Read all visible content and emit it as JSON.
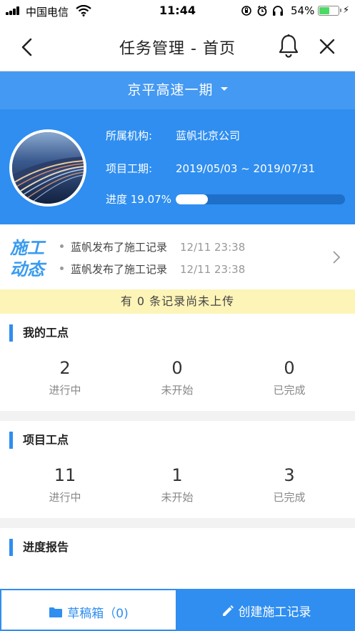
{
  "status_bar": {
    "carrier": "中国电信",
    "time": "11:44",
    "battery_percent": "54%",
    "battery_level": 0.54,
    "icons": [
      "signal-icon",
      "wifi-icon",
      "lock-rotation-icon",
      "alarm-icon",
      "headphones-icon",
      "battery-icon",
      "charging-icon"
    ]
  },
  "nav": {
    "title": "任务管理 - 首页",
    "icons": [
      "back-icon",
      "bell-icon",
      "close-icon"
    ]
  },
  "project": {
    "name": "京平高速一期",
    "org_label": "所属机构:",
    "org_value": "蓝帆北京公司",
    "period_label": "项目工期:",
    "period_value": "2019/05/03 ~ 2019/07/31",
    "progress_label": "进度 19.07%",
    "progress_value": 19.07
  },
  "activity": {
    "logo_line1": "施工",
    "logo_line2": "动态",
    "items": [
      {
        "text": "蓝帆发布了施工记录",
        "time": "12/11 23:38"
      },
      {
        "text": "蓝帆发布了施工记录",
        "time": "12/11 23:38"
      }
    ]
  },
  "upload_notice": "有 0 条记录尚未上传",
  "my_points": {
    "title": "我的工点",
    "stats": [
      {
        "value": "2",
        "label": "进行中"
      },
      {
        "value": "0",
        "label": "未开始"
      },
      {
        "value": "0",
        "label": "已完成"
      }
    ]
  },
  "project_points": {
    "title": "项目工点",
    "stats": [
      {
        "value": "11",
        "label": "进行中"
      },
      {
        "value": "1",
        "label": "未开始"
      },
      {
        "value": "3",
        "label": "已完成"
      }
    ]
  },
  "progress_report": {
    "title": "进度报告"
  },
  "bottom": {
    "draft_label": "草稿箱（0)",
    "create_label": "创建施工记录"
  },
  "colors": {
    "primary": "#2f8ef0",
    "notice_bg": "#fdf4b8",
    "battery_green": "#4cd964"
  }
}
